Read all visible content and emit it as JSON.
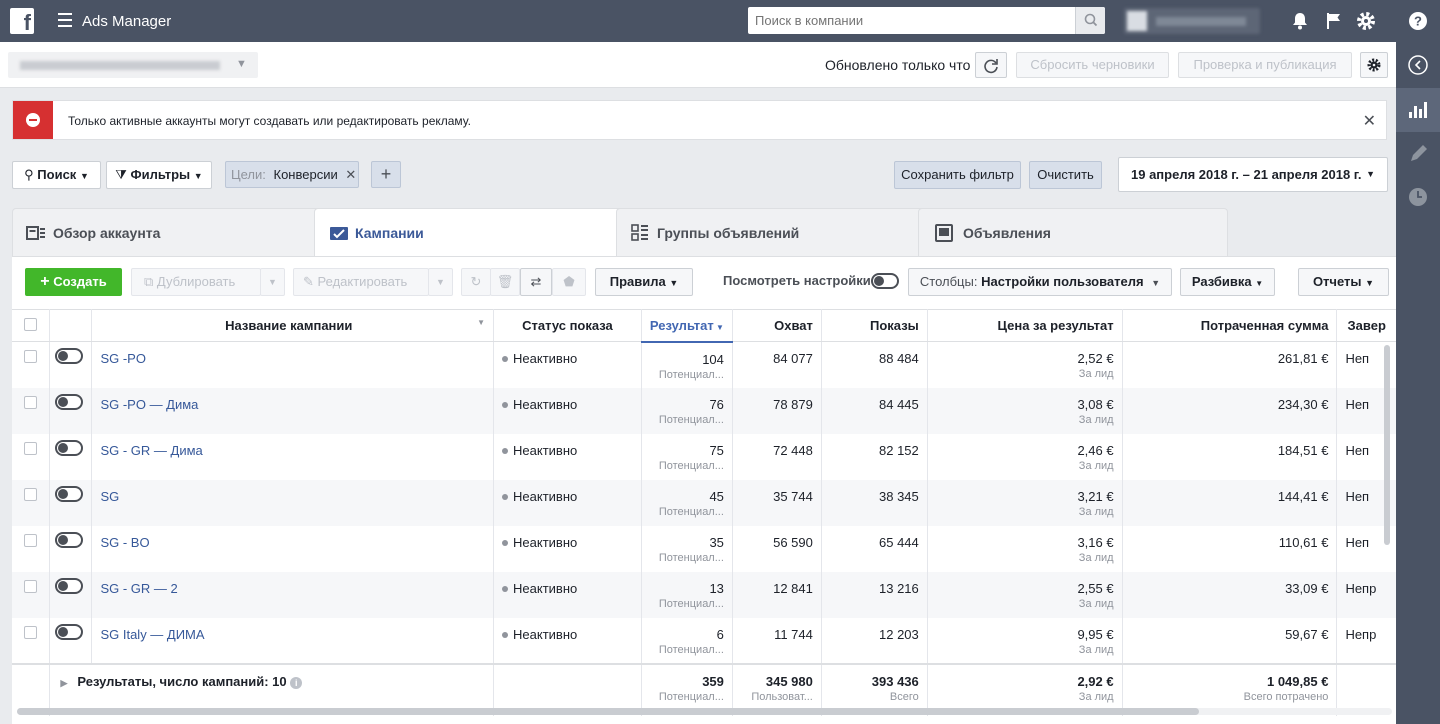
{
  "topbar": {
    "app_title": "Ads Manager",
    "search_placeholder": "Поиск в компании"
  },
  "subheader": {
    "updated": "Обновлено только что",
    "reset_drafts": "Сбросить черновики",
    "review_publish": "Проверка и публикация"
  },
  "alert": {
    "text": "Только активные аккаунты могут создавать или редактировать рекламу."
  },
  "filters": {
    "search": "Поиск",
    "filters": "Фильтры",
    "chip_key": "Цели:",
    "chip_value": "Конверсии",
    "save_filter": "Сохранить фильтр",
    "clear": "Очистить",
    "date_range": "19 апреля 2018 г. – 21 апреля 2018 г."
  },
  "tabs": [
    {
      "label": "Обзор аккаунта"
    },
    {
      "label": "Кампании"
    },
    {
      "label": "Группы объявлений"
    },
    {
      "label": "Объявления"
    }
  ],
  "toolbar": {
    "create": "Создать",
    "duplicate": "Дублировать",
    "edit": "Редактировать",
    "rules": "Правила",
    "view_settings": "Посмотреть настройки",
    "columns_prefix": "Столбцы:",
    "columns_value": "Настройки пользователя",
    "breakdown": "Разбивка",
    "reports": "Отчеты"
  },
  "table": {
    "headers": {
      "name": "Название кампании",
      "status": "Статус показа",
      "results": "Результат",
      "reach": "Охват",
      "impressions": "Показы",
      "cost": "Цена за результат",
      "spent": "Потраченная сумма",
      "end": "Завер"
    },
    "rows": [
      {
        "name": "SG -PO",
        "status": "Неактивно",
        "results": "104",
        "results_sub": "Потенциал...",
        "reach": "84 077",
        "impressions": "88 484",
        "cost": "2,52 €",
        "cost_sub": "За лид",
        "spent": "261,81 €",
        "end": "Неп"
      },
      {
        "name": "SG -PO — Дима",
        "status": "Неактивно",
        "results": "76",
        "results_sub": "Потенциал...",
        "reach": "78 879",
        "impressions": "84 445",
        "cost": "3,08 €",
        "cost_sub": "За лид",
        "spent": "234,30 €",
        "end": "Неп"
      },
      {
        "name": "SG - GR — Дима",
        "status": "Неактивно",
        "results": "75",
        "results_sub": "Потенциал...",
        "reach": "72 448",
        "impressions": "82 152",
        "cost": "2,46 €",
        "cost_sub": "За лид",
        "spent": "184,51 €",
        "end": "Неп"
      },
      {
        "name": "SG",
        "status": "Неактивно",
        "results": "45",
        "results_sub": "Потенциал...",
        "reach": "35 744",
        "impressions": "38 345",
        "cost": "3,21 €",
        "cost_sub": "За лид",
        "spent": "144,41 €",
        "end": "Неп"
      },
      {
        "name": "SG - BO",
        "status": "Неактивно",
        "results": "35",
        "results_sub": "Потенциал...",
        "reach": "56 590",
        "impressions": "65 444",
        "cost": "3,16 €",
        "cost_sub": "За лид",
        "spent": "110,61 €",
        "end": "Неп"
      },
      {
        "name": "SG - GR — 2",
        "status": "Неактивно",
        "results": "13",
        "results_sub": "Потенциал...",
        "reach": "12 841",
        "impressions": "13 216",
        "cost": "2,55 €",
        "cost_sub": "За лид",
        "spent": "33,09 €",
        "end": "Непр"
      },
      {
        "name": "SG Italy — ДИМА",
        "status": "Неактивно",
        "results": "6",
        "results_sub": "Потенциал...",
        "reach": "11 744",
        "impressions": "12 203",
        "cost": "9,95 €",
        "cost_sub": "За лид",
        "spent": "59,67 €",
        "end": "Непр"
      }
    ],
    "totals": {
      "label": "Результаты, число кампаний: 10",
      "results": "359",
      "results_sub": "Потенциал...",
      "reach": "345 980",
      "reach_sub": "Пользоват...",
      "impressions": "393 436",
      "impressions_sub": "Всего",
      "cost": "2,92 €",
      "cost_sub": "За лид",
      "spent": "1 049,85 €",
      "spent_sub": "Всего потрачено"
    }
  }
}
